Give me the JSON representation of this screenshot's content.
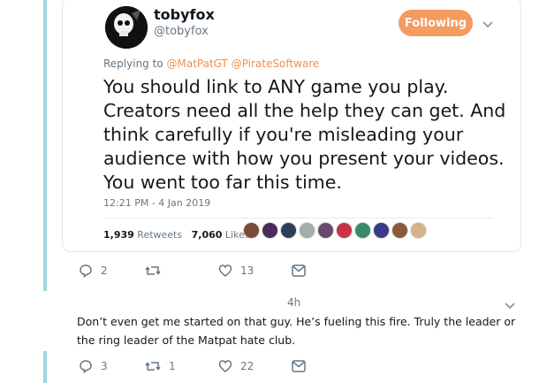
{
  "tweet": {
    "author": {
      "display_name": "tobyfox",
      "handle": "@tobyfox",
      "avatar_icon": "skull-avatar"
    },
    "follow_button_label": "Following",
    "follow_button_color": "#f49b60",
    "reply_prefix": "Replying to",
    "replying_to": [
      "@MatPatGT",
      "@PirateSoftware"
    ],
    "text_lines": [
      "You should link to ANY game you play.",
      "Creators need all the help they can get. And",
      "think carefully if you're misleading your",
      "audience with how you present your videos.",
      "You went too far this time."
    ],
    "timestamp": "12:21 PM - 4 Jan 2019",
    "retweets_count": "1,939",
    "retweets_label": "Retweets",
    "likes_count": "7,060",
    "likes_label": "Likes",
    "liker_avatars": [
      {
        "color": "#7a4a3a"
      },
      {
        "color": "#4a2c5a"
      },
      {
        "color": "#2c3e58"
      },
      {
        "color": "#a0b0a8"
      },
      {
        "color": "#6a4a6a"
      },
      {
        "color": "#c8324a"
      },
      {
        "color": "#3a8a6a"
      },
      {
        "color": "#3a3a8a"
      },
      {
        "color": "#8a5a3a"
      },
      {
        "color": "#d4b48a"
      }
    ]
  },
  "tweet_actions": {
    "reply_icon": "reply-icon",
    "replies": "2",
    "retweet_icon": "retweet-icon",
    "retweets": "",
    "like_icon": "heart-icon",
    "likes": "13",
    "message_icon": "envelope-icon"
  },
  "reply": {
    "time": "4h",
    "text_lines": [
      "Don’t even get me started on that guy. He’s  fueling this fire. Truly the leader or",
      "the ring leader of the Matpat hate club."
    ],
    "actions": {
      "replies": "3",
      "retweets": "1",
      "likes": "22"
    }
  },
  "colors": {
    "accent": "#f28f4a",
    "thread_line": "#9fd5df",
    "muted_text": "#657786"
  }
}
